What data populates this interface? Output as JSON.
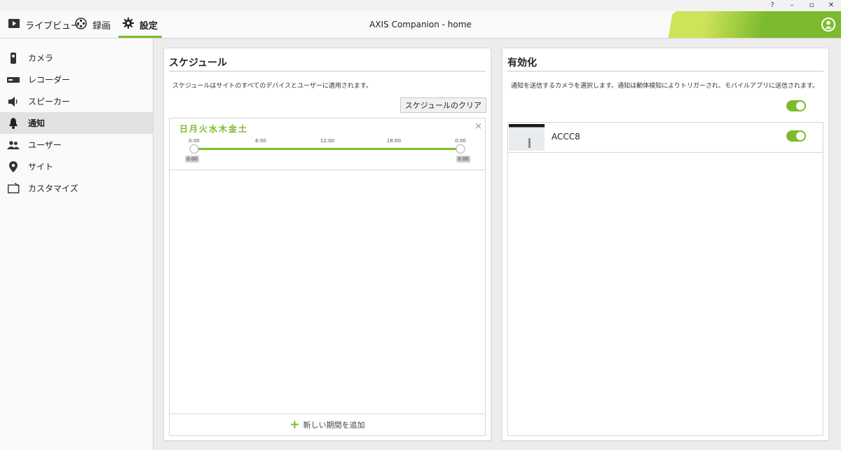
{
  "window": {
    "controls": {
      "help": "?",
      "minimize": "–",
      "restore": "▫",
      "close": "✕"
    }
  },
  "app": {
    "title": "AXIS Companion - home"
  },
  "nav": {
    "tabs": [
      {
        "label": "ライブビュー",
        "icon": "play-icon"
      },
      {
        "label": "録画",
        "icon": "film-reel-icon"
      },
      {
        "label": "設定",
        "icon": "gear-icon",
        "active": true
      }
    ]
  },
  "sidebar": {
    "items": [
      {
        "label": "カメラ",
        "icon": "camera-icon"
      },
      {
        "label": "レコーダー",
        "icon": "recorder-icon"
      },
      {
        "label": "スピーカー",
        "icon": "speaker-icon"
      },
      {
        "label": "通知",
        "icon": "bell-icon",
        "active": true
      },
      {
        "label": "ユーザー",
        "icon": "users-icon"
      },
      {
        "label": "サイト",
        "icon": "location-pin-icon"
      },
      {
        "label": "カスタマイズ",
        "icon": "customize-icon"
      }
    ]
  },
  "schedule": {
    "title": "スケジュール",
    "description": "スケジュールはサイトのすべてのデバイスとユーザーに適用されます。",
    "clear_button": "スケジュールのクリア",
    "days": "日月火水木金土",
    "close": "×",
    "ticks": [
      "0:00",
      "6:00",
      "12:00",
      "18:00",
      "0:00"
    ],
    "range": {
      "start": "0:00",
      "end": "0:00"
    },
    "add_period": "新しい期間を追加"
  },
  "enable": {
    "title": "有効化",
    "description": "通知を送信するカメラを選択します。通知は動体検知によりトリガーされ、モバイルアプリに送信されます。",
    "master_enabled": true,
    "cameras": [
      {
        "name": "ACCC8",
        "enabled": true
      }
    ]
  },
  "colors": {
    "accent": "#7dbb2e"
  }
}
